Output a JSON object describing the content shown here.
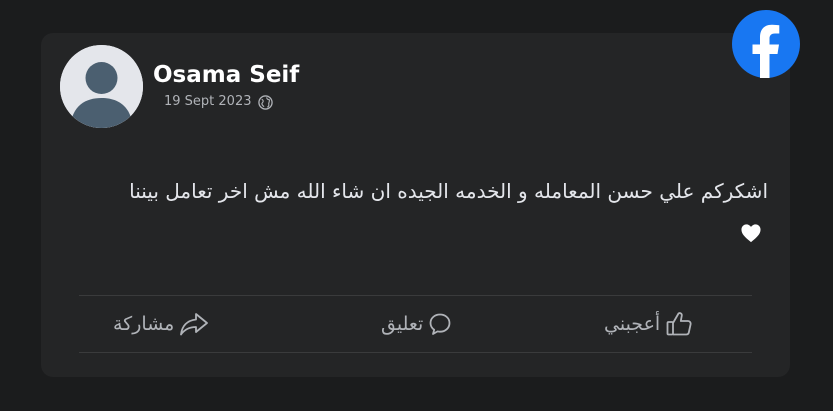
{
  "post": {
    "author": "Osama Seif",
    "date": "19 Sept 2023",
    "privacy_icon": "globe-icon",
    "text": "اشكركم علي حسن المعامله و الخدمه الجيده ان شاء الله مش اخر تعامل بيننا",
    "emoji_icon": "white-heart-icon"
  },
  "actions": {
    "like_label": "أعجبني",
    "comment_label": "تعليق",
    "share_label": "مشاركة"
  },
  "brand": {
    "logo_icon": "facebook-icon",
    "color": "#1877f2"
  },
  "colors": {
    "page_bg": "#1b1c1d",
    "card_bg": "#242526",
    "text_primary": "#e4e6eb",
    "text_secondary": "#b0b3b8"
  }
}
